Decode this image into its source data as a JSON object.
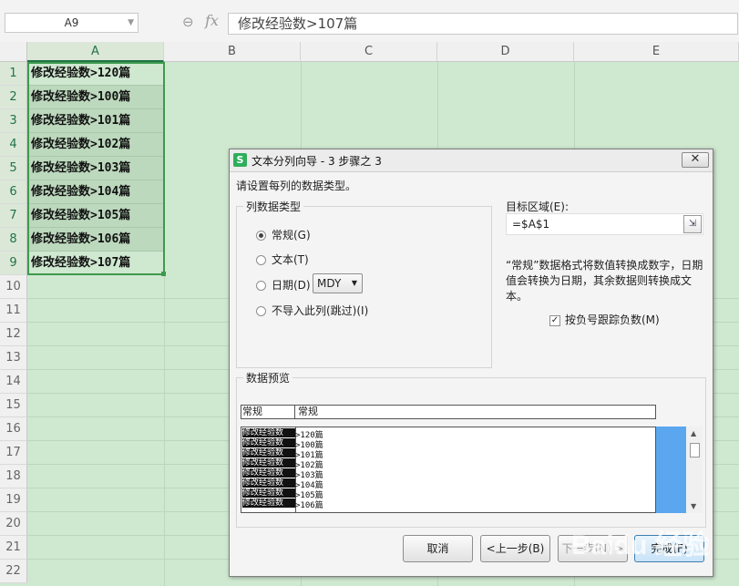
{
  "namebox": {
    "value": "A9"
  },
  "formula": {
    "fx": "fx",
    "value": "修改经验数>107篇"
  },
  "columns": [
    "A",
    "B",
    "C",
    "D",
    "E"
  ],
  "rows": [
    "1",
    "2",
    "3",
    "4",
    "5",
    "6",
    "7",
    "8",
    "9",
    "10",
    "11",
    "12",
    "13",
    "14",
    "15",
    "16",
    "17",
    "18",
    "19",
    "20",
    "21",
    "22"
  ],
  "cells": [
    "修改经验数>120篇",
    "修改经验数>100篇",
    "修改经验数>101篇",
    "修改经验数>102篇",
    "修改经验数>103篇",
    "修改经验数>104篇",
    "修改经验数>105篇",
    "修改经验数>106篇",
    "修改经验数>107篇"
  ],
  "dialog": {
    "app_icon": "S",
    "title": "文本分列向导 - 3 步骤之 3",
    "close": "✕",
    "instruction": "请设置每列的数据类型。",
    "column_type_group": "列数据类型",
    "options": [
      {
        "label": "常规(G)",
        "checked": true
      },
      {
        "label": "文本(T)",
        "checked": false
      },
      {
        "label": "日期(D)",
        "checked": false
      },
      {
        "label": "不导入此列(跳过)(I)",
        "checked": false
      }
    ],
    "date_format": "MDY",
    "target_label": "目标区域(E):",
    "target_value": "=$A$1",
    "description": "“常规”数据格式将数值转换成数字，日期值会转换为日期，其余数据则转换成文本。",
    "negative_checkbox": {
      "label": "按负号跟踪负数(M)",
      "checked": true
    },
    "preview_group": "数据预览",
    "preview_headers": [
      "常规",
      "常规"
    ],
    "preview_rows": [
      [
        "修改经验数",
        ">120篇"
      ],
      [
        "修改经验数",
        ">100篇"
      ],
      [
        "修改经验数",
        ">101篇"
      ],
      [
        "修改经验数",
        ">102篇"
      ],
      [
        "修改经验数",
        ">103篇"
      ],
      [
        "修改经验数",
        ">104篇"
      ],
      [
        "修改经验数",
        ">105篇"
      ],
      [
        "修改经验数",
        ">106篇"
      ]
    ],
    "buttons": {
      "cancel": "取消",
      "back": "<上一步(B)",
      "next": "下一步(N) >",
      "finish": "完成(F)"
    }
  },
  "watermark": "Baidu 经验",
  "colors": {
    "selection": "#3d9a4d",
    "sheet_bg": "#cfe8d0",
    "preview_highlight": "#5aa7f0"
  }
}
